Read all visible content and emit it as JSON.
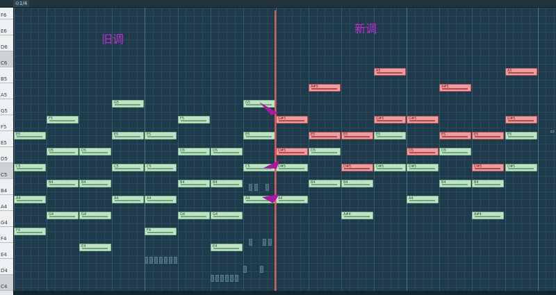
{
  "toolbar": {
    "snap_label": "⊙1/4"
  },
  "keyboard": {
    "keys": [
      "F6",
      "E6",
      "D6",
      "C6",
      "B5",
      "A5",
      "G5",
      "F5",
      "E5",
      "D5",
      "C5",
      "B4",
      "A4",
      "G4",
      "F4",
      "E4",
      "D4",
      "C4"
    ]
  },
  "labels": {
    "old_key": "旧调",
    "new_key": "新调"
  },
  "notes": [
    {
      "pitch": "C5",
      "label": "C5",
      "col": 0,
      "len": 1,
      "color": "green"
    },
    {
      "pitch": "E5",
      "label": "E5",
      "col": 0,
      "len": 1,
      "color": "green"
    },
    {
      "pitch": "A4",
      "label": "A4",
      "col": 0,
      "len": 1,
      "color": "green"
    },
    {
      "pitch": "F4",
      "label": "F4",
      "col": 0,
      "len": 1,
      "color": "green"
    },
    {
      "pitch": "F5",
      "label": "F5",
      "col": 1,
      "len": 1,
      "color": "green"
    },
    {
      "pitch": "D5",
      "label": "D5",
      "col": 1,
      "len": 1,
      "color": "green"
    },
    {
      "pitch": "B4",
      "label": "B4",
      "col": 1,
      "len": 1,
      "color": "green"
    },
    {
      "pitch": "G4",
      "label": "G4",
      "col": 1,
      "len": 1,
      "color": "green"
    },
    {
      "pitch": "D5",
      "label": "D5",
      "col": 2,
      "len": 1,
      "color": "green"
    },
    {
      "pitch": "B4",
      "label": "B4",
      "col": 2,
      "len": 1,
      "color": "green"
    },
    {
      "pitch": "G4",
      "label": "G4",
      "col": 2,
      "len": 1,
      "color": "green"
    },
    {
      "pitch": "E4",
      "label": "E4",
      "col": 2,
      "len": 1,
      "color": "green"
    },
    {
      "pitch": "G5",
      "label": "G5",
      "col": 3,
      "len": 1,
      "color": "green"
    },
    {
      "pitch": "E5",
      "label": "E5",
      "col": 3,
      "len": 1,
      "color": "green"
    },
    {
      "pitch": "C5",
      "label": "C5",
      "col": 3,
      "len": 1,
      "color": "green"
    },
    {
      "pitch": "A4",
      "label": "A4",
      "col": 3,
      "len": 1,
      "color": "green"
    },
    {
      "pitch": "E5",
      "label": "E5",
      "col": 4,
      "len": 1,
      "color": "green"
    },
    {
      "pitch": "C5",
      "label": "C5",
      "col": 4,
      "len": 1,
      "color": "green"
    },
    {
      "pitch": "A4",
      "label": "A4",
      "col": 4,
      "len": 1,
      "color": "green"
    },
    {
      "pitch": "F4",
      "label": "F4",
      "col": 4,
      "len": 1,
      "color": "green"
    },
    {
      "pitch": "F5",
      "label": "F5",
      "col": 5,
      "len": 1,
      "color": "green"
    },
    {
      "pitch": "D5",
      "label": "D5",
      "col": 5,
      "len": 1,
      "color": "green"
    },
    {
      "pitch": "B4",
      "label": "B4",
      "col": 5,
      "len": 1,
      "color": "green"
    },
    {
      "pitch": "G4",
      "label": "G4",
      "col": 5,
      "len": 1,
      "color": "green"
    },
    {
      "pitch": "D5",
      "label": "D5",
      "col": 6,
      "len": 1,
      "color": "green"
    },
    {
      "pitch": "B4",
      "label": "B4",
      "col": 6,
      "len": 1,
      "color": "green"
    },
    {
      "pitch": "G4",
      "label": "G4",
      "col": 6,
      "len": 1,
      "color": "green"
    },
    {
      "pitch": "E4",
      "label": "E4",
      "col": 6,
      "len": 1,
      "color": "green"
    },
    {
      "pitch": "G5",
      "label": "G5",
      "col": 7,
      "len": 1,
      "color": "green"
    },
    {
      "pitch": "E5",
      "label": "E5",
      "col": 7,
      "len": 1,
      "color": "green"
    },
    {
      "pitch": "C5",
      "label": "C5",
      "col": 7,
      "len": 1,
      "color": "green"
    },
    {
      "pitch": "A4",
      "label": "A4",
      "col": 7,
      "len": 1,
      "color": "green"
    },
    {
      "pitch": "F5",
      "label": "G#5",
      "col": 8,
      "len": 1,
      "color": "red"
    },
    {
      "pitch": "D5",
      "label": "D#5",
      "col": 8,
      "len": 1,
      "color": "red"
    },
    {
      "pitch": "C5",
      "label": "D#5",
      "col": 8,
      "len": 1,
      "color": "green"
    },
    {
      "pitch": "A4",
      "label": "A4",
      "col": 8,
      "len": 1,
      "color": "green"
    },
    {
      "pitch": "A5",
      "label": "A#5",
      "col": 9,
      "len": 1,
      "color": "red"
    },
    {
      "pitch": "E5",
      "label": "E5",
      "col": 9,
      "len": 1,
      "color": "red"
    },
    {
      "pitch": "D5",
      "label": "D5",
      "col": 9,
      "len": 1,
      "color": "green"
    },
    {
      "pitch": "B4",
      "label": "B4",
      "col": 9,
      "len": 1,
      "color": "green"
    },
    {
      "pitch": "E5",
      "label": "E5",
      "col": 10,
      "len": 1,
      "color": "red"
    },
    {
      "pitch": "C5",
      "label": "D#5",
      "col": 10,
      "len": 1,
      "color": "red"
    },
    {
      "pitch": "B4",
      "label": "B4",
      "col": 10,
      "len": 1,
      "color": "green"
    },
    {
      "pitch": "G4",
      "label": "A#4",
      "col": 10,
      "len": 1,
      "color": "green"
    },
    {
      "pitch": "B5",
      "label": "A5",
      "col": 11,
      "len": 1,
      "color": "red"
    },
    {
      "pitch": "F5",
      "label": "G#5",
      "col": 11,
      "len": 1,
      "color": "red"
    },
    {
      "pitch": "E5",
      "label": "E5",
      "col": 11,
      "len": 1,
      "color": "green"
    },
    {
      "pitch": "C5",
      "label": "D#5",
      "col": 11,
      "len": 1,
      "color": "green"
    },
    {
      "pitch": "F5",
      "label": "G#5",
      "col": 12,
      "len": 1,
      "color": "red"
    },
    {
      "pitch": "D5",
      "label": "D5",
      "col": 12,
      "len": 1,
      "color": "red"
    },
    {
      "pitch": "C5",
      "label": "D#5",
      "col": 12,
      "len": 1,
      "color": "green"
    },
    {
      "pitch": "A4",
      "label": "A4",
      "col": 12,
      "len": 1,
      "color": "green"
    },
    {
      "pitch": "A5",
      "label": "A#5",
      "col": 13,
      "len": 1,
      "color": "red"
    },
    {
      "pitch": "E5",
      "label": "E5",
      "col": 13,
      "len": 1,
      "color": "red"
    },
    {
      "pitch": "D5",
      "label": "D5",
      "col": 13,
      "len": 1,
      "color": "green"
    },
    {
      "pitch": "B4",
      "label": "B4",
      "col": 13,
      "len": 1,
      "color": "green"
    },
    {
      "pitch": "E5",
      "label": "E5",
      "col": 14,
      "len": 1,
      "color": "red"
    },
    {
      "pitch": "C5",
      "label": "D#5",
      "col": 14,
      "len": 1,
      "color": "red"
    },
    {
      "pitch": "B4",
      "label": "B4",
      "col": 14,
      "len": 1,
      "color": "green"
    },
    {
      "pitch": "G4",
      "label": "A#4",
      "col": 14,
      "len": 1,
      "color": "green"
    },
    {
      "pitch": "B5",
      "label": "A5",
      "col": 15,
      "len": 1,
      "color": "red"
    },
    {
      "pitch": "F5",
      "label": "G#5",
      "col": 15,
      "len": 1,
      "color": "red"
    },
    {
      "pitch": "E5",
      "label": "E5",
      "col": 15,
      "len": 1,
      "color": "green"
    },
    {
      "pitch": "C5",
      "label": "D#5",
      "col": 15,
      "len": 1,
      "color": "green"
    }
  ],
  "colors": {
    "note_green": "#bfe3c6",
    "note_red": "#ec9d9f",
    "playhead": "#f0524d",
    "annotation": "#c02fd6",
    "grid_bg": "#1f3a4a"
  }
}
